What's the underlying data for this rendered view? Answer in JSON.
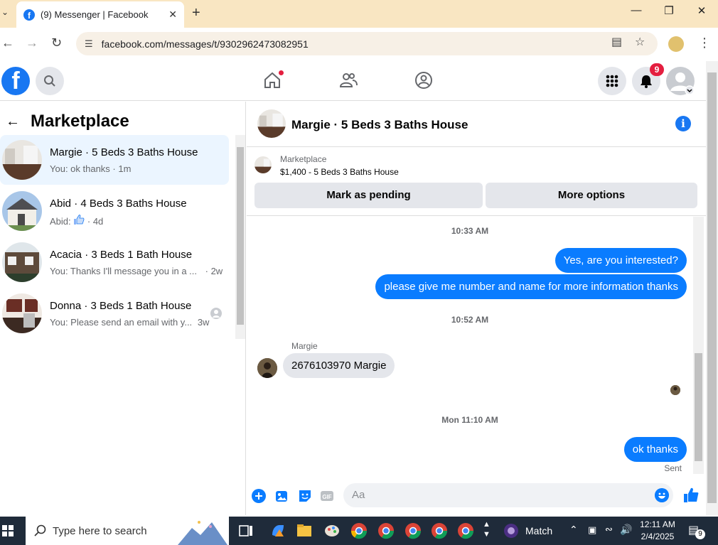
{
  "browser": {
    "tab_title": "(9) Messenger | Facebook",
    "url": "facebook.com/messages/t/9302962473082951"
  },
  "fb": {
    "notification_count": "9",
    "brand_color": "#1877f2"
  },
  "left": {
    "title": "Marketplace",
    "conversations": [
      {
        "name": "Margie · 5 Beds 3 Baths House",
        "preview": "You: ok thanks · 1m"
      },
      {
        "name": "Abid · 4 Beds 3 Baths House",
        "preview_sender": "Abid:",
        "preview_time": "· 4d"
      },
      {
        "name": "Acacia · 3 Beds 1 Bath House",
        "preview": "You: Thanks I'll message you in a ...",
        "time": "· 2w"
      },
      {
        "name": "Donna · 3 Beds 1 Bath House",
        "preview": "You: Please send an email with y...",
        "time": "3w"
      }
    ]
  },
  "chat": {
    "title": "Margie · 5 Beds 3 Baths House",
    "marketplace_label": "Marketplace",
    "listing": "$1,400 - 5 Beds 3 Baths House",
    "mark_pending": "Mark as pending",
    "more_options": "More options",
    "messages": {
      "t1": "10:33 AM",
      "m1": "Yes, are you interested?",
      "m2": "please give me number and name for more information thanks",
      "t2": "10:52 AM",
      "sender": "Margie",
      "m3": "2676103970 Margie",
      "t3": "Mon 11:10 AM",
      "m4": "ok thanks",
      "status": "Sent"
    },
    "composer_placeholder": "Aa"
  },
  "taskbar": {
    "search_placeholder": "Type here to search",
    "match_label": "Match",
    "time": "12:11 AM",
    "date": "2/4/2025",
    "notif_count": "9"
  }
}
